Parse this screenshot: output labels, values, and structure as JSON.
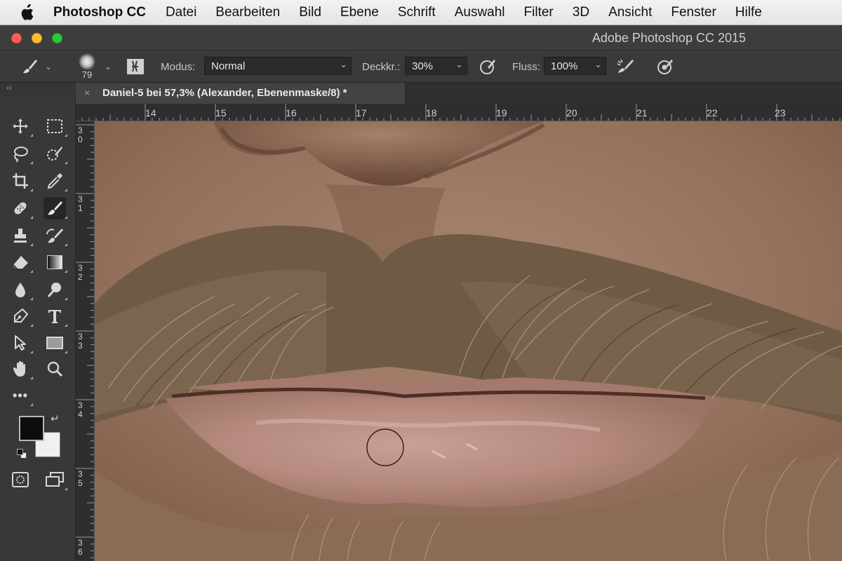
{
  "menubar": {
    "app_name": "Photoshop CC",
    "items": [
      "Datei",
      "Bearbeiten",
      "Bild",
      "Ebene",
      "Schrift",
      "Auswahl",
      "Filter",
      "3D",
      "Ansicht",
      "Fenster",
      "Hilfe"
    ]
  },
  "window": {
    "title": "Adobe Photoshop CC 2015"
  },
  "options": {
    "brush_size": "79",
    "mode_label": "Modus:",
    "mode_value": "Normal",
    "opacity_label": "Deckkr.:",
    "opacity_value": "30%",
    "flow_label": "Fluss:",
    "flow_value": "100%"
  },
  "document": {
    "tab_title": "Daniel-5 bei 57,3% (Alexander, Ebenenmaske/8) *",
    "close_glyph": "×"
  },
  "rulers": {
    "horizontal": [
      "14",
      "15",
      "16",
      "17",
      "18",
      "19",
      "20",
      "21",
      "22",
      "23"
    ],
    "vertical": [
      "30",
      "31",
      "32",
      "33",
      "34",
      "35",
      "36"
    ]
  },
  "panel": {
    "collapse_glyph": "‹‹"
  },
  "colors": {
    "foreground": "#0d0d0d",
    "background": "#f0f0f0",
    "close_light": "#fc5f57",
    "minimize_light": "#fdbc2e",
    "zoom_light": "#28c840"
  },
  "tools": [
    "move-icon",
    "marquee-icon",
    "lasso-icon",
    "quick-selection-icon",
    "crop-icon",
    "eyedropper-icon",
    "healing-brush-icon",
    "brush-icon",
    "clone-stamp-icon",
    "history-brush-icon",
    "eraser-icon",
    "gradient-icon",
    "blur-icon",
    "dodge-icon",
    "pen-icon",
    "type-icon",
    "path-selection-icon",
    "rectangle-icon",
    "hand-icon",
    "zoom-icon",
    "more-tools-icon"
  ]
}
